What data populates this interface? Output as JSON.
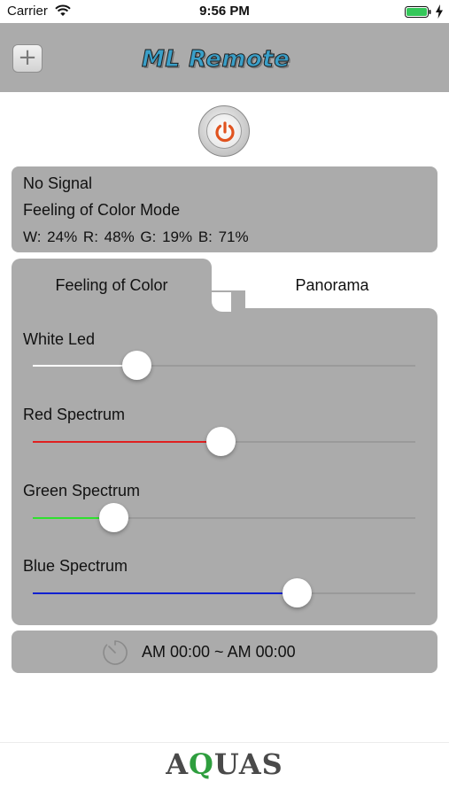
{
  "status_bar": {
    "carrier": "Carrier",
    "time": "9:56 PM"
  },
  "nav": {
    "add_label": "+",
    "title": "ML Remote"
  },
  "info": {
    "signal": "No Signal",
    "mode": "Feeling of Color Mode",
    "levels": "W: 24%  R: 48%  G: 19%  B: 71%"
  },
  "tabs": {
    "feeling": "Feeling of Color",
    "panorama": "Panorama"
  },
  "sliders": [
    {
      "label": "White Led",
      "value": 0.27,
      "color": "#ffffff"
    },
    {
      "label": "Red Spectrum",
      "value": 0.49,
      "color": "#e02020"
    },
    {
      "label": "Green Spectrum",
      "value": 0.21,
      "color": "#2ee02e"
    },
    {
      "label": "Blue Spectrum",
      "value": 0.69,
      "color": "#1020d0"
    }
  ],
  "timer": {
    "range": "AM 00:00 ~ AM 00:00"
  },
  "footer": {
    "logo_part1": "A",
    "logo_part2": "Q",
    "logo_part3": "UAS"
  },
  "colors": {
    "panel": "#ababab",
    "power_accent": "#e0531f",
    "battery": "#34c759"
  },
  "icons": {
    "wifi": "wifi-icon",
    "battery": "battery-icon",
    "power": "power-icon",
    "timer": "timer-icon",
    "add": "plus-icon"
  }
}
